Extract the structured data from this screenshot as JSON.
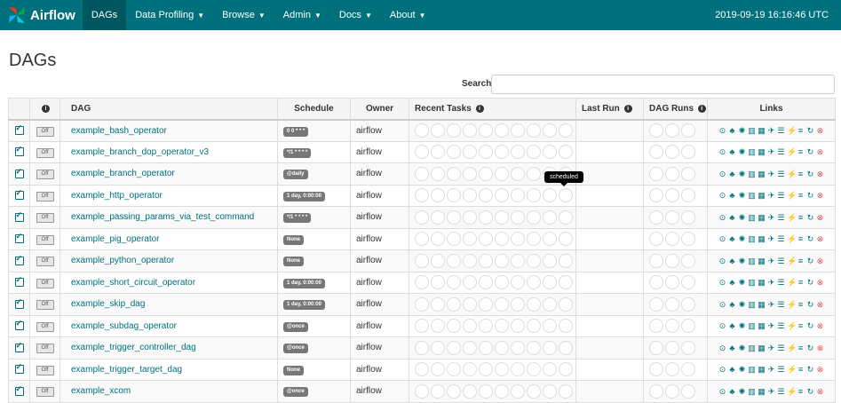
{
  "nav": {
    "brand": "Airflow",
    "items": [
      {
        "label": "DAGs",
        "active": true,
        "caret": false
      },
      {
        "label": "Data Profiling",
        "active": false,
        "caret": true
      },
      {
        "label": "Browse",
        "active": false,
        "caret": true
      },
      {
        "label": "Admin",
        "active": false,
        "caret": true
      },
      {
        "label": "Docs",
        "active": false,
        "caret": true
      },
      {
        "label": "About",
        "active": false,
        "caret": true
      }
    ],
    "clock": "2019-09-19 16:16:46 UTC"
  },
  "page": {
    "title": "DAGs"
  },
  "search": {
    "label": "Search:",
    "value": "",
    "placeholder": ""
  },
  "table": {
    "headers": {
      "dag": "DAG",
      "schedule": "Schedule",
      "owner": "Owner",
      "recent_tasks": "Recent Tasks",
      "last_run": "Last Run",
      "dag_runs": "DAG Runs",
      "links": "Links"
    },
    "toggle_label": "Off",
    "rows": [
      {
        "dag": "example_bash_operator",
        "schedule": "0 0 * * *",
        "owner": "airflow"
      },
      {
        "dag": "example_branch_dop_operator_v3",
        "schedule": "*/1 * * * *",
        "owner": "airflow"
      },
      {
        "dag": "example_branch_operator",
        "schedule": "@daily",
        "owner": "airflow"
      },
      {
        "dag": "example_http_operator",
        "schedule": "1 day, 0:00:00",
        "owner": "airflow"
      },
      {
        "dag": "example_passing_params_via_test_command",
        "schedule": "*/1 * * * *",
        "owner": "airflow"
      },
      {
        "dag": "example_pig_operator",
        "schedule": "None",
        "owner": "airflow"
      },
      {
        "dag": "example_python_operator",
        "schedule": "None",
        "owner": "airflow"
      },
      {
        "dag": "example_short_circuit_operator",
        "schedule": "1 day, 0:00:00",
        "owner": "airflow"
      },
      {
        "dag": "example_skip_dag",
        "schedule": "1 day, 0:00:00",
        "owner": "airflow"
      },
      {
        "dag": "example_subdag_operator",
        "schedule": "@once",
        "owner": "airflow"
      },
      {
        "dag": "example_trigger_controller_dag",
        "schedule": "@once",
        "owner": "airflow"
      },
      {
        "dag": "example_trigger_target_dag",
        "schedule": "None",
        "owner": "airflow"
      },
      {
        "dag": "example_xcom",
        "schedule": "@once",
        "owner": "airflow"
      }
    ]
  },
  "tooltip": {
    "text": "scheduled"
  },
  "link_icons": [
    "trigger-dag-icon",
    "tree-view-icon",
    "graph-view-icon",
    "tasks-duration-icon",
    "task-tries-icon",
    "landing-times-icon",
    "gantt-icon",
    "code-view-icon",
    "logs-icon",
    "refresh-icon",
    "delete-icon"
  ],
  "colors": {
    "navbar": "#00717c",
    "nav_active": "#00565e",
    "link": "#00717c",
    "delete": "#d9534f"
  }
}
